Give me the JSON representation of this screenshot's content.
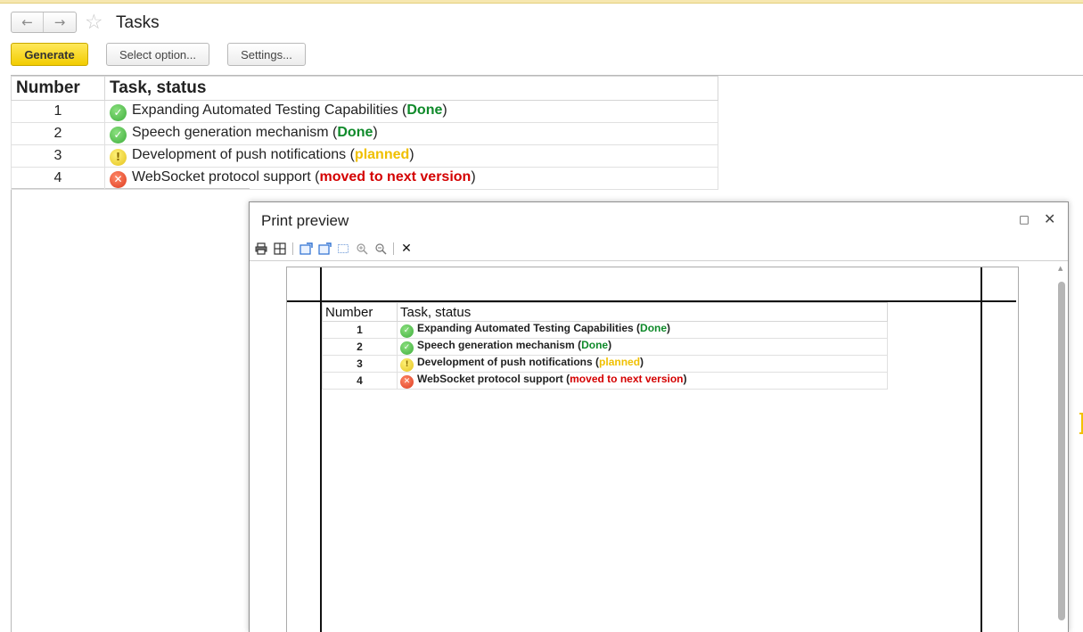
{
  "nav": {
    "back_icon": "←",
    "forward_icon": "→",
    "favorite_icon": "☆"
  },
  "header": {
    "title": "Tasks"
  },
  "toolbar": {
    "generate_label": "Generate",
    "select_option_label": "Select option...",
    "settings_label": "Settings..."
  },
  "report": {
    "columns": [
      "Number",
      "Task, status"
    ],
    "rows": [
      {
        "number": "1",
        "task": "Expanding Automated Testing Capabilities",
        "status": "Done",
        "status_type": "done"
      },
      {
        "number": "2",
        "task": "Speech generation mechanism",
        "status": "Done",
        "status_type": "done"
      },
      {
        "number": "3",
        "task": "Development of push notifications",
        "status": "planned",
        "status_type": "planned"
      },
      {
        "number": "4",
        "task": "WebSocket protocol support",
        "status": "moved to next version",
        "status_type": "moved"
      }
    ]
  },
  "status_colors": {
    "done": "#0f8a2a",
    "planned": "#f0c000",
    "moved": "#d40000"
  },
  "status_icons": {
    "done": "check-circle-icon",
    "planned": "exclamation-circle-icon",
    "moved": "x-circle-icon"
  },
  "print_preview": {
    "title": "Print preview",
    "maximize_icon": "□",
    "close_icon": "✕",
    "toolbar_icons": [
      "print-icon",
      "page-setup-icon",
      "export-icon",
      "export-alt-icon",
      "fit-page-icon",
      "zoom-in-icon",
      "zoom-out-icon",
      "close-preview-icon"
    ]
  }
}
